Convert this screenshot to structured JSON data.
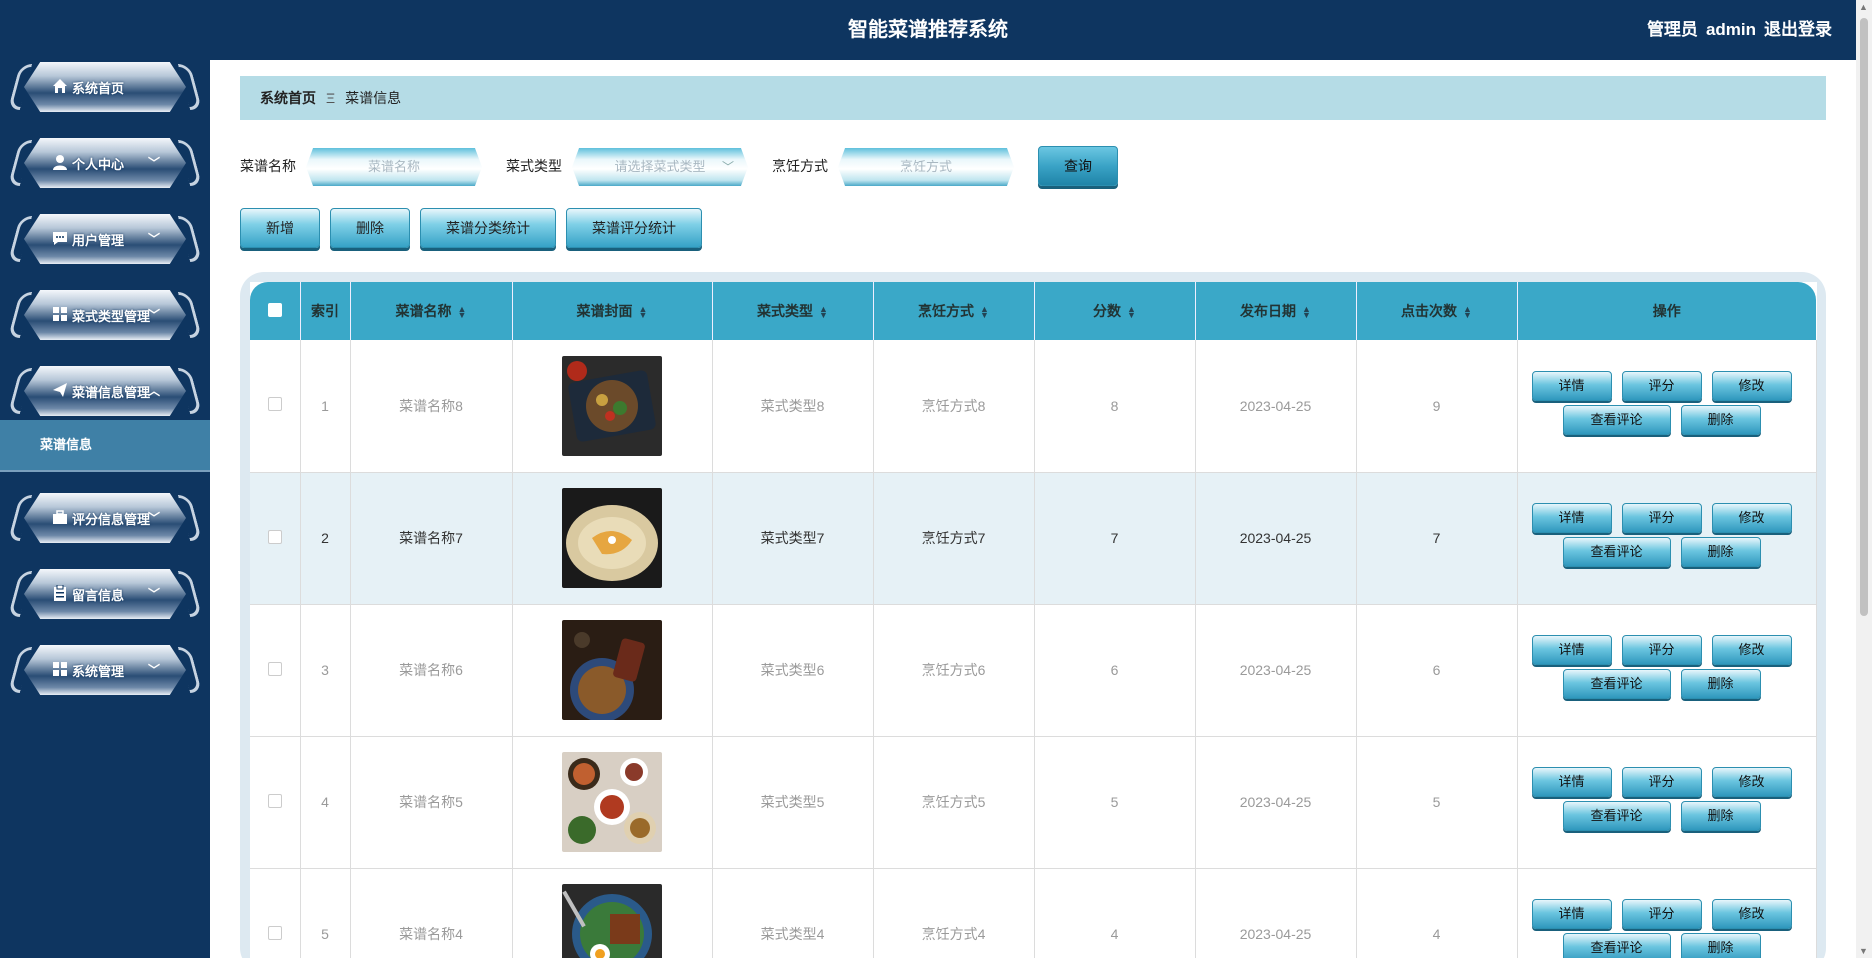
{
  "header": {
    "title": "智能菜谱推荐系统",
    "role": "管理员",
    "username": "admin",
    "logout": "退出登录"
  },
  "sidebar": {
    "items": [
      {
        "label": "系统首页",
        "icon": "home-icon",
        "expanded": null
      },
      {
        "label": "个人中心",
        "icon": "user-icon",
        "expanded": false
      },
      {
        "label": "用户管理",
        "icon": "chat-icon",
        "expanded": false
      },
      {
        "label": "菜式类型管理",
        "icon": "grid-icon",
        "expanded": false
      },
      {
        "label": "菜谱信息管理",
        "icon": "send-icon",
        "expanded": true
      },
      {
        "label": "评分信息管理",
        "icon": "briefcase-icon",
        "expanded": false
      },
      {
        "label": "留言信息",
        "icon": "clipboard-icon",
        "expanded": false
      },
      {
        "label": "系统管理",
        "icon": "grid-icon",
        "expanded": false
      }
    ],
    "active_sub": "菜谱信息"
  },
  "breadcrumb": {
    "home": "系统首页",
    "separator": "Ξ",
    "current": "菜谱信息"
  },
  "search": {
    "name_label": "菜谱名称",
    "name_placeholder": "菜谱名称",
    "type_label": "菜式类型",
    "type_placeholder": "请选择菜式类型",
    "method_label": "烹饪方式",
    "method_placeholder": "烹饪方式",
    "query": "查询"
  },
  "actions": {
    "add": "新增",
    "delete": "删除",
    "category_stats": "菜谱分类统计",
    "rating_stats": "菜谱评分统计"
  },
  "table": {
    "columns": [
      "索引",
      "菜谱名称",
      "菜谱封面",
      "菜式类型",
      "烹饪方式",
      "分数",
      "发布日期",
      "点击次数",
      "操作"
    ],
    "rows": [
      {
        "index": "1",
        "name": "菜谱名称8",
        "type": "菜式类型8",
        "method": "烹饪方式8",
        "score": "8",
        "date": "2023-04-25",
        "clicks": "9"
      },
      {
        "index": "2",
        "name": "菜谱名称7",
        "type": "菜式类型7",
        "method": "烹饪方式7",
        "score": "7",
        "date": "2023-04-25",
        "clicks": "7"
      },
      {
        "index": "3",
        "name": "菜谱名称6",
        "type": "菜式类型6",
        "method": "烹饪方式6",
        "score": "6",
        "date": "2023-04-25",
        "clicks": "6"
      },
      {
        "index": "4",
        "name": "菜谱名称5",
        "type": "菜式类型5",
        "method": "烹饪方式5",
        "score": "5",
        "date": "2023-04-25",
        "clicks": "5"
      },
      {
        "index": "5",
        "name": "菜谱名称4",
        "type": "菜式类型4",
        "method": "烹饪方式4",
        "score": "4",
        "date": "2023-04-25",
        "clicks": "4"
      }
    ],
    "ops": {
      "detail": "详情",
      "rate": "评分",
      "edit": "修改",
      "comments": "查看评论",
      "delete": "删除"
    }
  },
  "colors": {
    "navy": "#0e3560",
    "accent": "#3aa8c8",
    "breadcrumb_bg": "#b5dce6",
    "row_highlight": "#e6f1f6"
  }
}
